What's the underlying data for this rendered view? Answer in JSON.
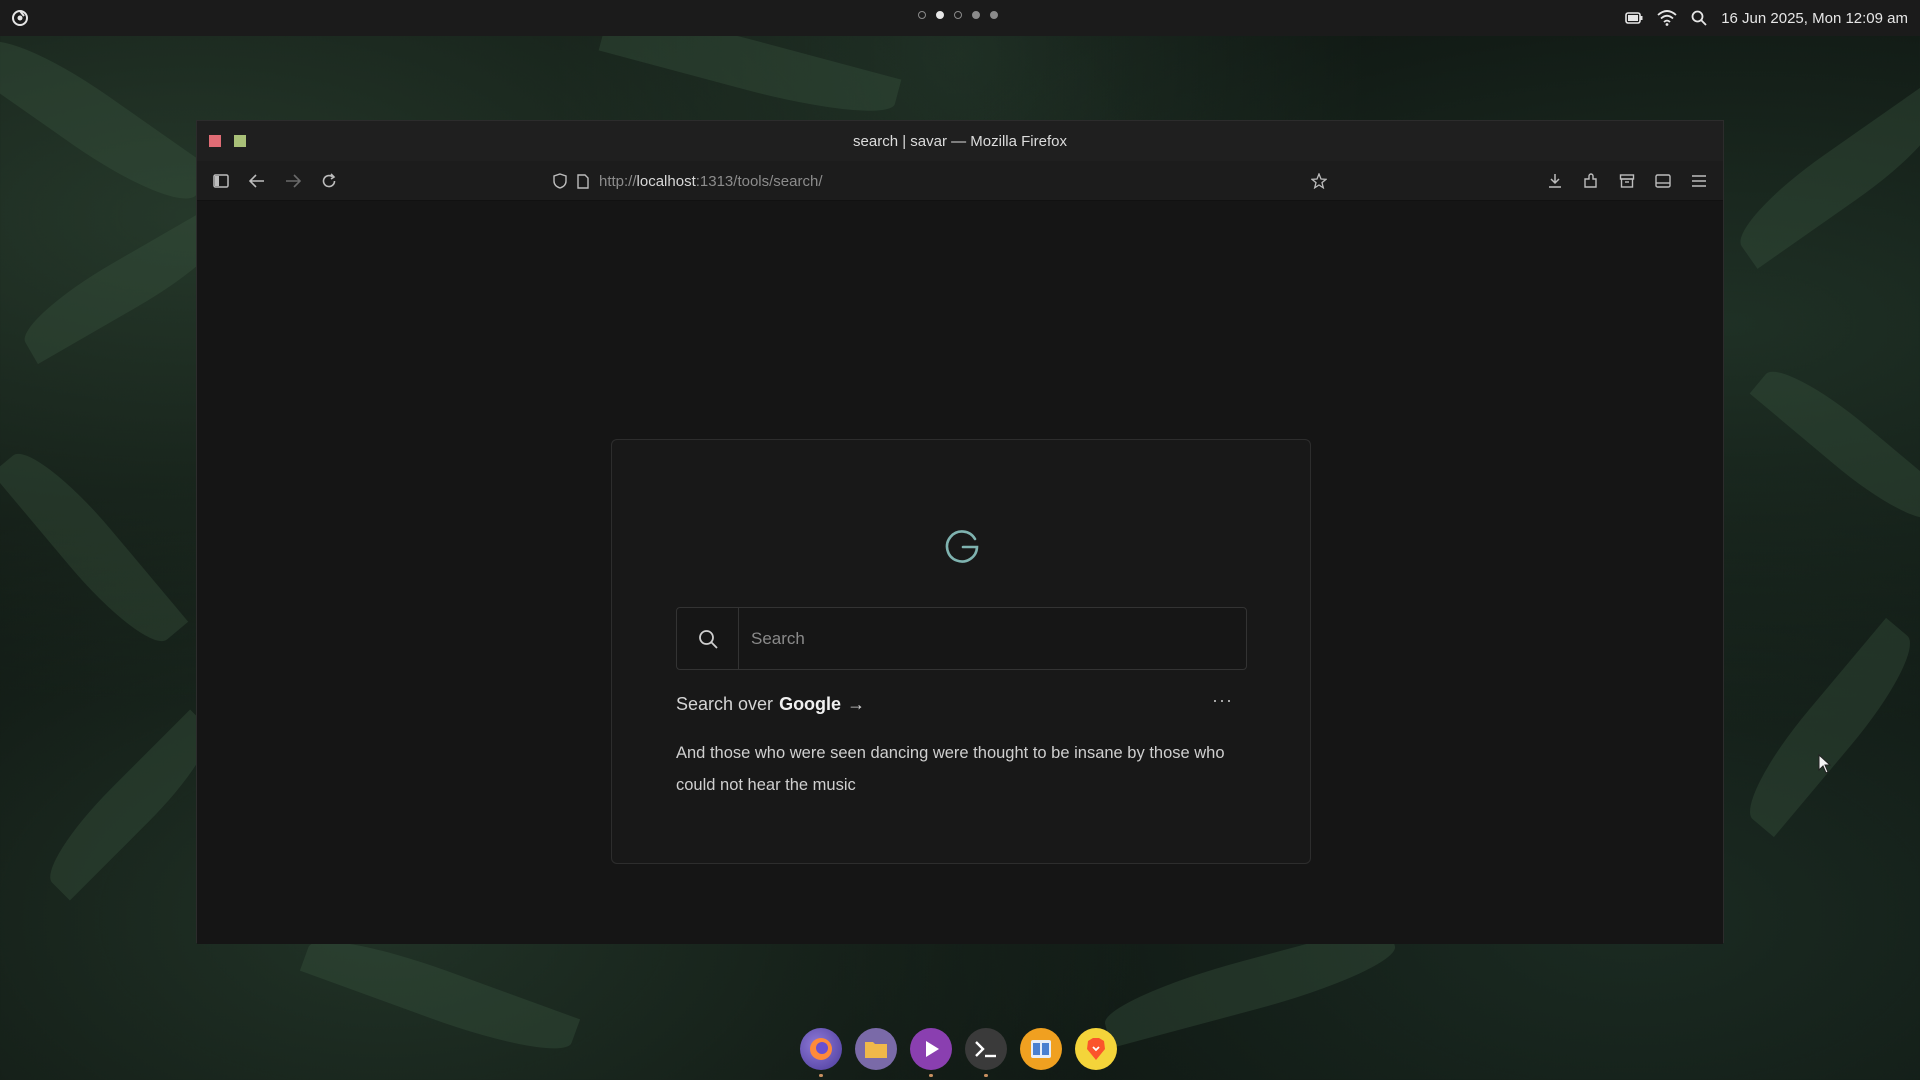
{
  "topbar": {
    "workspaces": [
      {
        "state": "empty"
      },
      {
        "state": "active"
      },
      {
        "state": "empty"
      },
      {
        "state": "filled"
      },
      {
        "state": "filled"
      }
    ],
    "clock": "16 Jun 2025, Mon 12:09 am",
    "tray_icons": [
      "battery-icon",
      "wifi-icon",
      "search-icon"
    ]
  },
  "window": {
    "title": "search | savar — Mozilla Firefox",
    "url_scheme": "http://",
    "url_host": "localhost",
    "url_rest": ":1313/tools/search/"
  },
  "search_page": {
    "placeholder": "Search",
    "search_over_prefix": "Search over",
    "search_over_engine": "Google",
    "search_over_arrow": "→",
    "more_label": "···",
    "quote": "And those who were seen dancing were thought to be insane by those who could not hear the music"
  },
  "dock": {
    "apps": [
      "firefox-icon",
      "files-icon",
      "media-player-icon",
      "terminal-icon",
      "reader-icon",
      "brave-icon"
    ]
  },
  "colors": {
    "accent_google": "#7fb3b0",
    "close": "#e06c75",
    "maximize": "#a9c078"
  }
}
